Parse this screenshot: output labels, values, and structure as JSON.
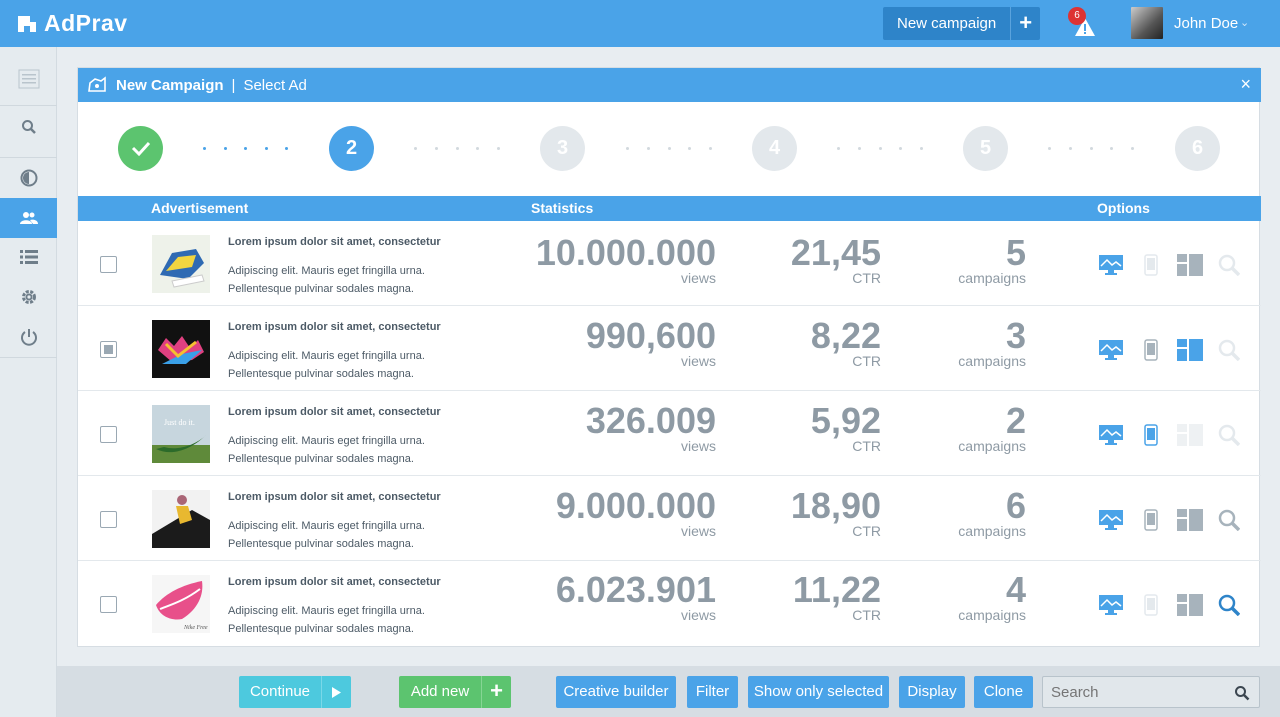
{
  "brand": "AdPrav",
  "header": {
    "new_campaign_label": "New campaign",
    "alert_count": "6",
    "user_name": "John Doe"
  },
  "panel": {
    "title": "New Campaign",
    "separator": "|",
    "subtitle": "Select Ad",
    "close": "×"
  },
  "steps": [
    {
      "label": "",
      "state": "done"
    },
    {
      "label": "2",
      "state": "current"
    },
    {
      "label": "3",
      "state": "pending"
    },
    {
      "label": "4",
      "state": "pending"
    },
    {
      "label": "5",
      "state": "pending"
    },
    {
      "label": "6",
      "state": "pending"
    }
  ],
  "table": {
    "headers": [
      "Advertisement",
      "Statistics",
      "Options"
    ],
    "rows": [
      {
        "title": "Lorem ipsum dolor sit amet, consectetur",
        "desc1": "Adipiscing elit. Mauris eget fringilla urna.",
        "desc2": "Pellentesque pulvinar sodales magna.",
        "views": "10.000.000",
        "views_unit": "views",
        "ctr": "21,45",
        "ctr_unit": "CTR",
        "campaigns": "5",
        "campaigns_unit": "campaigns",
        "selected": false,
        "opts": {
          "desktop": true,
          "mobile": false,
          "layout": "gray",
          "search": false
        }
      },
      {
        "title": "Lorem ipsum dolor sit amet, consectetur",
        "desc1": "Adipiscing elit. Mauris eget fringilla urna.",
        "desc2": "Pellentesque pulvinar sodales magna.",
        "views": "990,600",
        "views_unit": "views",
        "ctr": "8,22",
        "ctr_unit": "CTR",
        "campaigns": "3",
        "campaigns_unit": "campaigns",
        "selected": true,
        "opts": {
          "desktop": true,
          "mobile": "gray",
          "layout": "blue",
          "search": false
        }
      },
      {
        "title": "Lorem ipsum dolor sit amet, consectetur",
        "desc1": "Adipiscing elit. Mauris eget fringilla urna.",
        "desc2": "Pellentesque pulvinar sodales magna.",
        "views": "326.009",
        "views_unit": "views",
        "ctr": "5,92",
        "ctr_unit": "CTR",
        "campaigns": "2",
        "campaigns_unit": "campaigns",
        "selected": false,
        "opts": {
          "desktop": true,
          "mobile": "blue",
          "layout": "off",
          "search": false
        }
      },
      {
        "title": "Lorem ipsum dolor sit amet, consectetur",
        "desc1": "Adipiscing elit. Mauris eget fringilla urna.",
        "desc2": "Pellentesque pulvinar sodales magna.",
        "views": "9.000.000",
        "views_unit": "views",
        "ctr": "18,90",
        "ctr_unit": "CTR",
        "campaigns": "6",
        "campaigns_unit": "campaigns",
        "selected": false,
        "opts": {
          "desktop": true,
          "mobile": "gray",
          "layout": "gray",
          "search": "gray"
        }
      },
      {
        "title": "Lorem ipsum dolor sit amet, consectetur",
        "desc1": "Adipiscing elit. Mauris eget fringilla urna.",
        "desc2": "Pellentesque pulvinar sodales magna.",
        "views": "6.023.901",
        "views_unit": "views",
        "ctr": "11,22",
        "ctr_unit": "CTR",
        "campaigns": "4",
        "campaigns_unit": "campaigns",
        "selected": false,
        "opts": {
          "desktop": true,
          "mobile": false,
          "layout": "gray",
          "search": "blue"
        }
      }
    ]
  },
  "footer": {
    "continue": "Continue",
    "add_new": "Add new",
    "creative_builder": "Creative builder",
    "filter": "Filter",
    "show_only_selected": "Show only selected",
    "display": "Display",
    "clone": "Clone",
    "search_placeholder": "Search"
  },
  "colors": {
    "primary": "#4aa3e8",
    "success": "#5cc46f",
    "teal": "#4dc9de",
    "alert": "#d33333"
  }
}
